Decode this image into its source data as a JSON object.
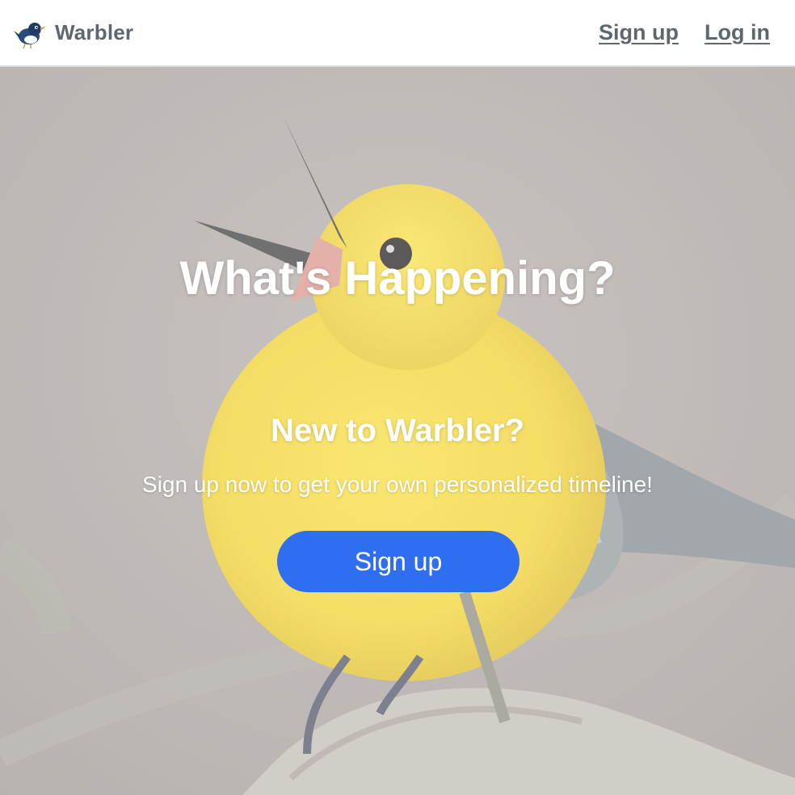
{
  "nav": {
    "brand": "Warbler",
    "logo_icon": "bird-logo-icon",
    "links": [
      "Sign up",
      "Log in"
    ]
  },
  "hero": {
    "title": "What's Happening?",
    "subtitle": "New to Warbler?",
    "text": "Sign up now to get your own personalized timeline!",
    "cta_label": "Sign up",
    "background_image": "yellow-warbler-bird-photo",
    "cta_color": "#2f6ef0"
  }
}
